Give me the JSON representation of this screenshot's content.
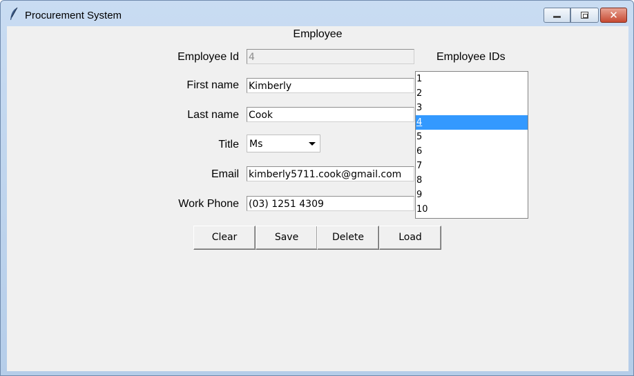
{
  "window": {
    "title": "Procurement System",
    "icon": "feather-icon",
    "controls": [
      "minimize",
      "maximize",
      "close"
    ]
  },
  "form": {
    "heading": "Employee",
    "employee_id": {
      "label": "Employee Id",
      "value": "4",
      "disabled": true
    },
    "first_name": {
      "label": "First name",
      "value": "Kimberly"
    },
    "last_name": {
      "label": "Last name",
      "value": "Cook"
    },
    "title": {
      "label": "Title",
      "value": "Ms"
    },
    "email": {
      "label": "Email",
      "value": "kimberly5711.cook@gmail.com"
    },
    "work_phone": {
      "label": "Work Phone",
      "value": "(03) 1251 4309"
    }
  },
  "employee_ids": {
    "label": "Employee IDs",
    "items": [
      "1",
      "2",
      "3",
      "4",
      "5",
      "6",
      "7",
      "8",
      "9",
      "10"
    ],
    "selected": "4"
  },
  "buttons": {
    "clear": "Clear",
    "save": "Save",
    "delete": "Delete",
    "load": "Load"
  },
  "colors": {
    "selection": "#3399ff",
    "close_button": "#c74a32"
  }
}
